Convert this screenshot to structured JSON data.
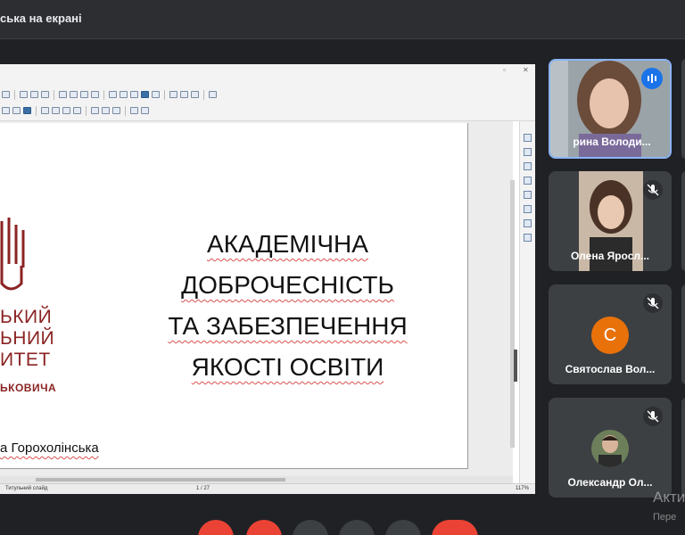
{
  "window": {
    "title": "ська на екрані"
  },
  "presentation": {
    "slide_title_lines": [
      "АКАДЕМІЧНА",
      "ДОБРОЧЕСНІСТЬ",
      "ТА ЗАБЕЗПЕЧЕННЯ",
      "ЯКОСТІ ОСВІТИ"
    ],
    "logo_lines": [
      "ЬКИЙ",
      "ЬНИЙ",
      "ИТЕТ"
    ],
    "logo_small": "ЬКОВИЧА",
    "author": "а Горохолінська",
    "status_left": "Титульний слайд",
    "status_mid": "1 / 27",
    "status_right": "117%",
    "accent_color": "#8b2323"
  },
  "participants": [
    {
      "name": "рина Володи...",
      "mic": "speaking"
    },
    {
      "name": "Олена Яросл...",
      "mic": "muted"
    },
    {
      "name": "Святослав Вол...",
      "mic": "muted",
      "avatar_letter": "С",
      "avatar_color": "#e8710a"
    },
    {
      "name": "Олександр Ол...",
      "mic": "muted"
    }
  ],
  "controls": [
    "mic-button",
    "camera-button",
    "raise-hand-button",
    "present-button",
    "more-options-button",
    "leave-call-button"
  ],
  "activation_notice": {
    "title": "Акти",
    "subtitle": "Пере"
  }
}
